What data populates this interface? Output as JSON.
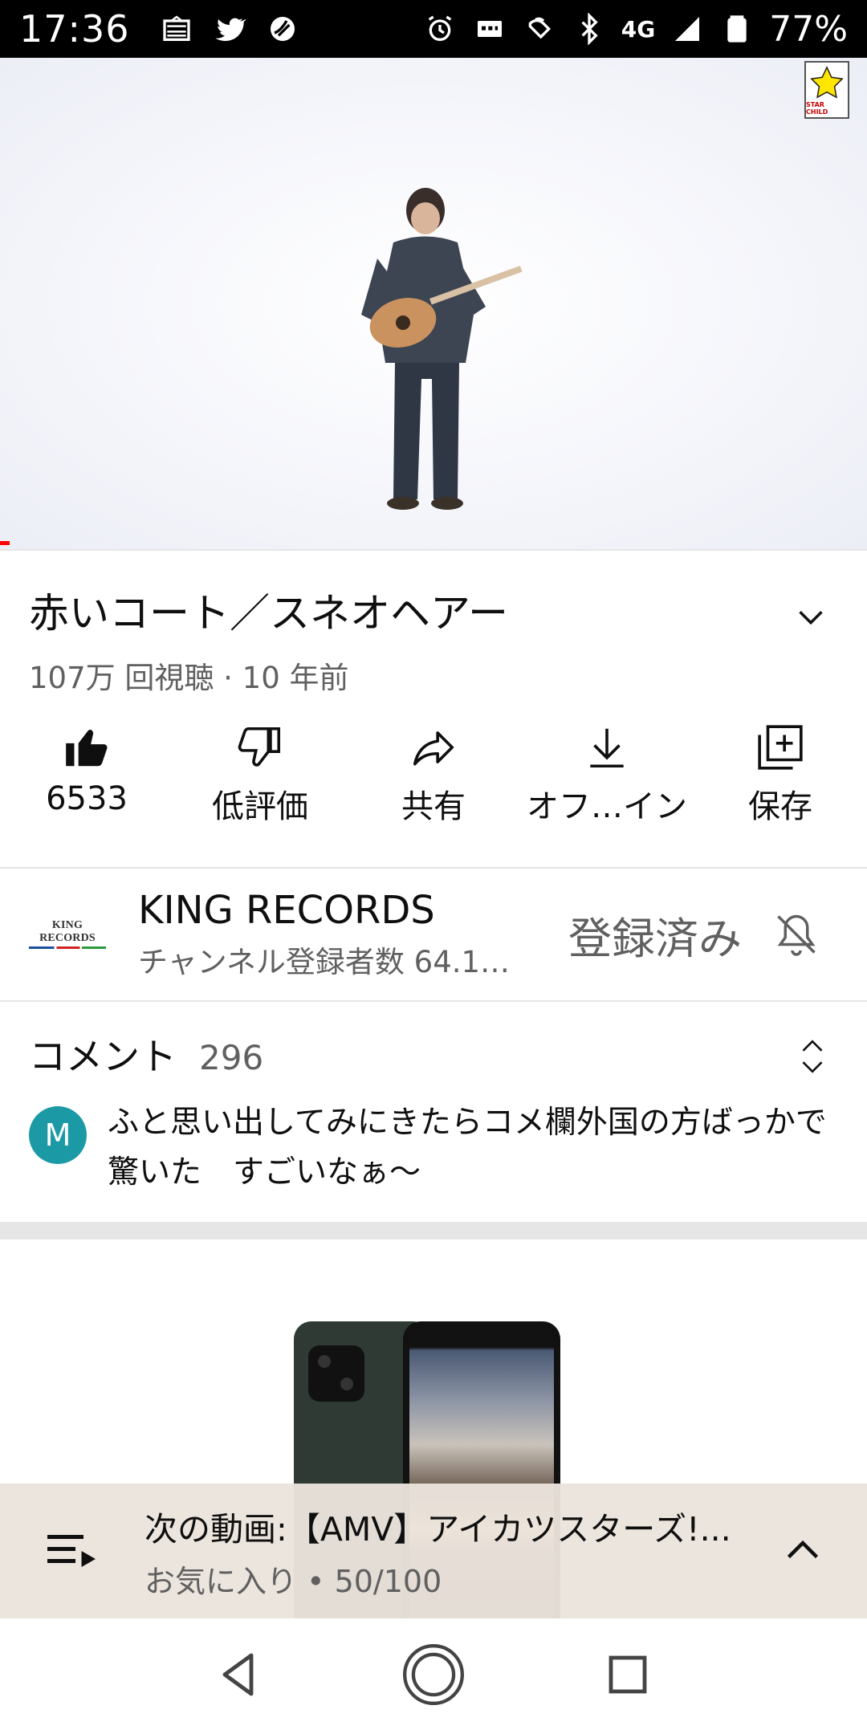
{
  "status_bar": {
    "time": "17:36",
    "network": "4G",
    "battery": "77%",
    "left_icons": [
      "news-icon",
      "twitter-icon",
      "app-icon"
    ],
    "right_icons": [
      "alarm-icon",
      "sim-icon",
      "nfc-icon",
      "bluetooth-icon",
      "signal-icon",
      "battery-icon"
    ]
  },
  "video": {
    "badge_text": "STAR CHILD"
  },
  "title": {
    "text": "赤いコート／スネオヘアー",
    "meta": "107万 回視聴 · 10 年前"
  },
  "actions": [
    {
      "label": "6533",
      "icon": "thumbs-up-icon"
    },
    {
      "label": "低評価",
      "icon": "thumbs-down-icon"
    },
    {
      "label": "共有",
      "icon": "share-icon"
    },
    {
      "label": "オフ…イン",
      "icon": "download-icon"
    },
    {
      "label": "保存",
      "icon": "save-icon"
    }
  ],
  "channel": {
    "logo_text": "KING RECORDS",
    "name": "KING RECORDS",
    "subscribers": "チャンネル登録者数 64.1…",
    "subscribe_label": "登録済み"
  },
  "comments": {
    "title": "コメント",
    "count": "296",
    "avatar_letter": "M",
    "top_comment": "ふと思い出してみにきたらコメ欄外国の方ばっかで驚いた　すごいなぁ〜"
  },
  "next_video": {
    "title": "次の動画:【AMV】アイカツスターズ!...",
    "playlist": "お気に入り • 50/100"
  },
  "colors": {
    "accent_red": "#ff0000",
    "avatar_teal": "#1b9aa6",
    "next_bar_bg": "#ebe4dd"
  }
}
